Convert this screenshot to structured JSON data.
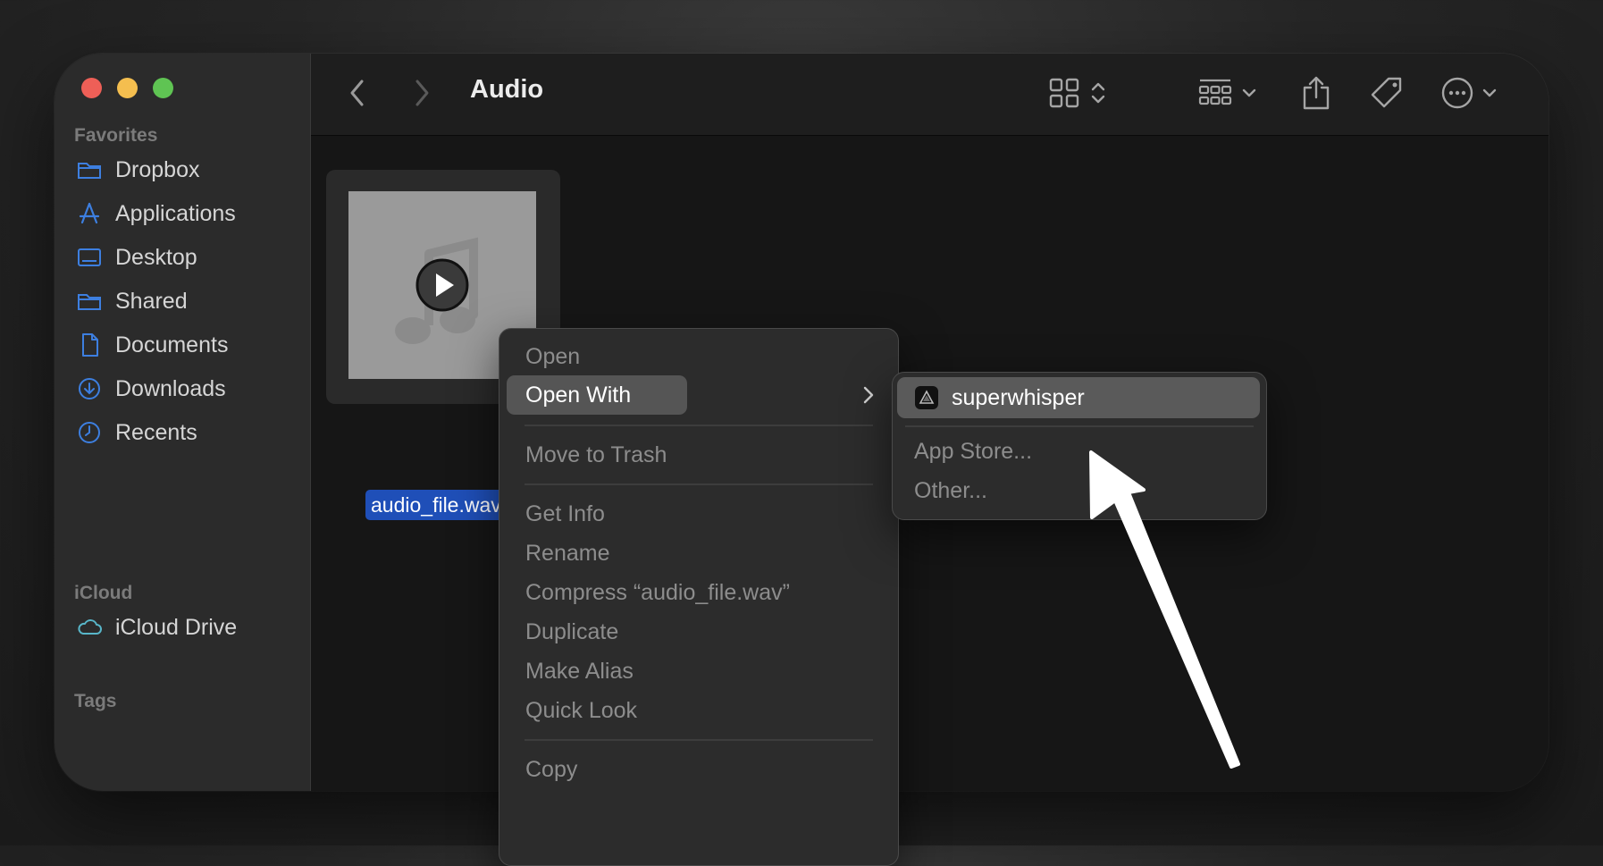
{
  "window": {
    "title": "Audio"
  },
  "sidebar": {
    "favorites_label": "Favorites",
    "favorites": [
      {
        "label": "Dropbox",
        "icon": "folder-icon"
      },
      {
        "label": "Applications",
        "icon": "applications-icon"
      },
      {
        "label": "Desktop",
        "icon": "desktop-icon"
      },
      {
        "label": "Shared",
        "icon": "folder-icon"
      },
      {
        "label": "Documents",
        "icon": "document-icon"
      },
      {
        "label": "Downloads",
        "icon": "download-icon"
      },
      {
        "label": "Recents",
        "icon": "clock-icon"
      }
    ],
    "icloud_label": "iCloud",
    "icloud": [
      {
        "label": "iCloud Drive",
        "icon": "cloud-icon"
      }
    ],
    "tags_label": "Tags"
  },
  "file": {
    "name": "audio_file.wav"
  },
  "context_menu": {
    "open": "Open",
    "open_with": "Open With",
    "move_to_trash": "Move to Trash",
    "get_info": "Get Info",
    "rename": "Rename",
    "compress": "Compress “audio_file.wav”",
    "duplicate": "Duplicate",
    "make_alias": "Make Alias",
    "quick_look": "Quick Look",
    "copy": "Copy"
  },
  "open_with_submenu": {
    "app": "superwhisper",
    "app_store": "App Store...",
    "other": "Other..."
  },
  "colors": {
    "accent_selection": "#1f4fb8",
    "sidebar_icon": "#3d7fe0",
    "icloud_icon": "#58b6c9",
    "annotation_arrow": "#ffffff"
  }
}
